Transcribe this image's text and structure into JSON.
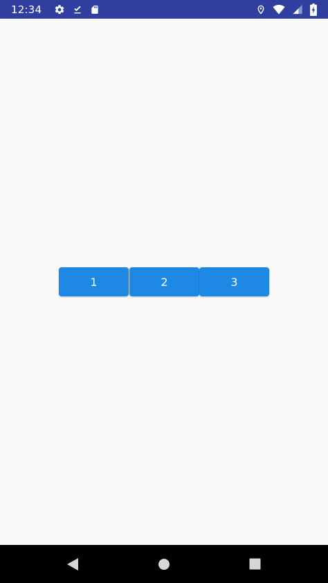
{
  "status_bar": {
    "time": "12:34",
    "background_color": "#303f9f",
    "left_icons": [
      "settings-icon",
      "download-done-icon",
      "sd-card-icon"
    ],
    "right_icons": [
      "location-icon",
      "wifi-icon",
      "signal-icon",
      "battery-charging-icon"
    ]
  },
  "content": {
    "background_color": "#fafafa",
    "buttons": [
      {
        "label": "1"
      },
      {
        "label": "2"
      },
      {
        "label": "3"
      }
    ],
    "button_color": "#1e88e5"
  },
  "navigation_bar": {
    "items": [
      "back-icon",
      "home-icon",
      "recents-icon"
    ]
  }
}
